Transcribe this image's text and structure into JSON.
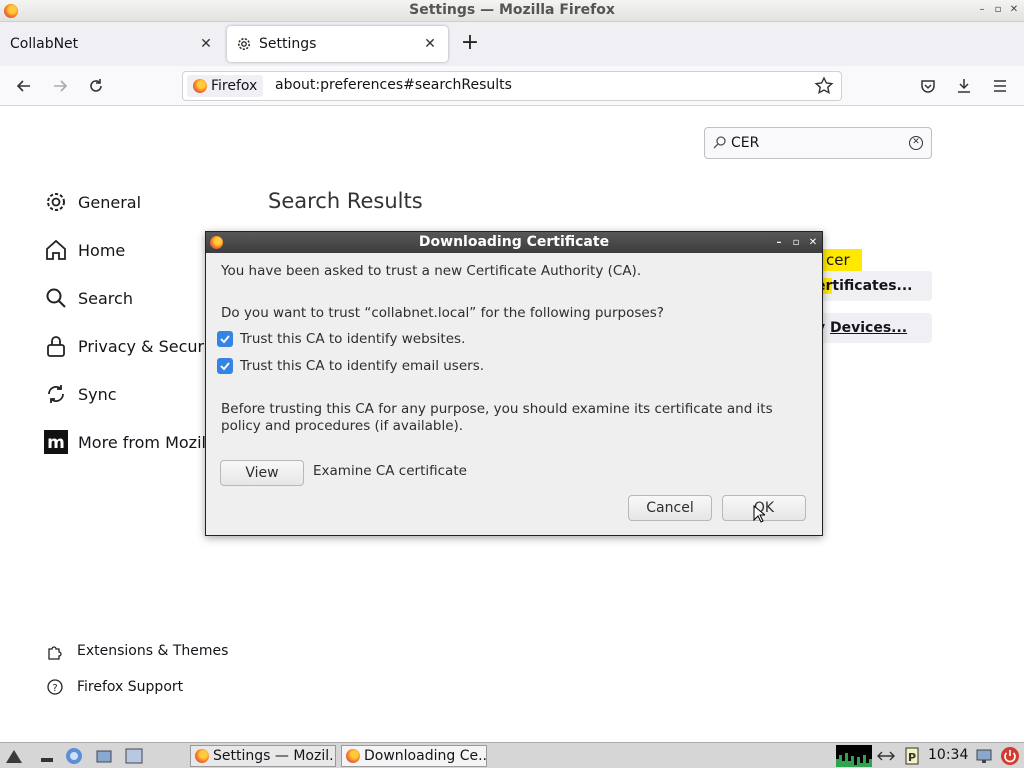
{
  "window": {
    "title": "Settings — Mozilla Firefox"
  },
  "tabs": [
    {
      "label": "CollabNet",
      "active": false
    },
    {
      "label": "Settings",
      "active": true
    }
  ],
  "urlbar": {
    "identity": "Firefox",
    "url": "about:preferences#searchResults"
  },
  "settings": {
    "search_value": "CER",
    "categories": [
      {
        "label": "General",
        "icon": "gear-icon"
      },
      {
        "label": "Home",
        "icon": "home-icon"
      },
      {
        "label": "Search",
        "icon": "search-icon"
      },
      {
        "label": "Privacy & Securi",
        "icon": "lock-icon"
      },
      {
        "label": "Sync",
        "icon": "sync-icon"
      },
      {
        "label": "More from Mozil",
        "icon": "mozilla-icon"
      }
    ],
    "results_title": "Search Results",
    "tooltip_text": "cer",
    "result_buttons": [
      {
        "pre": "",
        "hl": "er",
        "post": "tificates..."
      },
      {
        "pre": "y ",
        "hl": "",
        "post": "Devices..."
      }
    ],
    "footer": [
      {
        "label": "Extensions & Themes",
        "icon": "puzzle-icon"
      },
      {
        "label": "Firefox Support",
        "icon": "help-icon"
      }
    ]
  },
  "dialog": {
    "title": "Downloading Certificate",
    "intro": "You have been asked to trust a new Certificate Authority (CA).",
    "question": "Do you want to trust “collabnet.local” for the following purposes?",
    "checkboxes": [
      {
        "label": "Trust this CA to identify websites.",
        "checked": true
      },
      {
        "label": "Trust this CA to identify email users.",
        "checked": true
      }
    ],
    "advice_line1": "Before trusting this CA for any purpose, you should examine its certificate and its",
    "advice_line2": "policy and procedures (if available).",
    "view_button": "View",
    "view_caption": "Examine CA certificate",
    "cancel_button": "Cancel",
    "ok_button": "OK"
  },
  "taskbar": {
    "tasks": [
      {
        "label": "Settings — Mozil..."
      },
      {
        "label": "Downloading Ce..."
      }
    ],
    "clock": "10:34"
  },
  "colors": {
    "checkbox": "#3584e4",
    "highlight": "#ffe900",
    "dialog_title": "#484848"
  }
}
